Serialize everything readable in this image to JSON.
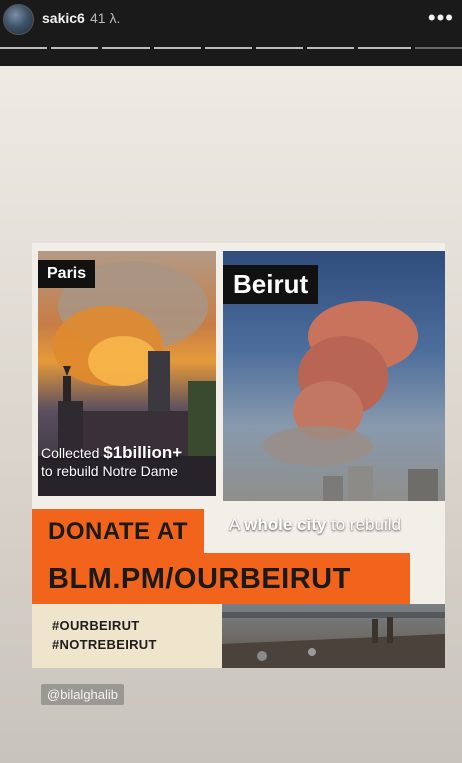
{
  "header": {
    "username": "sakic6",
    "time": "41 λ.",
    "more_icon": "more-horizontal-icon"
  },
  "progress": {
    "total_segments": 9,
    "current_segment": 9
  },
  "poster": {
    "paris_label": "Paris",
    "paris_caption_pre": "Collected ",
    "paris_caption_amount": "$1billion+",
    "paris_caption_post": "to rebuild Notre Dame",
    "beirut_label": "Beirut",
    "beirut_caption_pre": "A ",
    "beirut_caption_bold": "whole city",
    "beirut_caption_post": " to rebuild",
    "donate_line": "DONATE AT",
    "url_line": "BLM.PM/OURBEIRUT",
    "hashtag_1": "#OURBEIRUT",
    "hashtag_2": "#NOTREBEIRUT"
  },
  "mention": "@bilalghalib",
  "colors": {
    "accent_orange": "#f2641b",
    "cream": "#efe4cc",
    "topbar": "#1a1a1a"
  }
}
